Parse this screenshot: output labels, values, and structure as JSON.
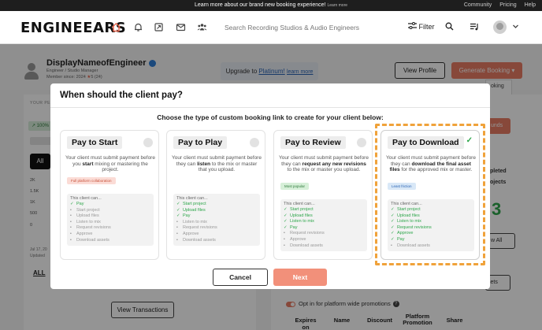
{
  "banner": {
    "message": "Learn more about our brand new booking experience!",
    "learn_more": "Learn more",
    "links": [
      "Community",
      "Pricing",
      "Help"
    ]
  },
  "nav": {
    "logo": "ENGINEEARS",
    "search_placeholder": "Search Recording Studios & Audio Engineers",
    "filter_label": "Filter",
    "icons": [
      "home-icon",
      "bell-icon",
      "document-icon",
      "mail-icon",
      "people-icon",
      "search-icon",
      "queue-icon",
      "avatar",
      "chevron-down-icon"
    ]
  },
  "profile": {
    "name": "DisplayNameofEngineer",
    "role": "Engineer / Studio Manager",
    "member_since": "Member since: 2024",
    "rating": "5 (24)",
    "upgrade_text": "Upgrade to ",
    "upgrade_link": "Platinum!",
    "learn_more": "learn more",
    "view_profile": "View Profile",
    "generate_booking": "Generate Booking",
    "dropdown_items": [
      "oking",
      "oking"
    ]
  },
  "background": {
    "your_label": "YOUR PE",
    "pct": "100%",
    "tab_all": "All",
    "y_ticks": [
      "2K",
      "1.5K",
      "1K",
      "500",
      "0"
    ],
    "date": "Jul 17, 20",
    "updated": "Updated",
    "all_tab": "ALL",
    "view_transactions": "View Transactions",
    "funds": "unds",
    "side_texts": [
      "pleted",
      "ojects"
    ],
    "big_number": "3",
    "view_all": "w All",
    "assets": "sets",
    "optin": "Opt in for platform wide promotions",
    "table_headers": [
      "Expires on",
      "Name",
      "Discount",
      "Platform Promotion",
      "Share"
    ]
  },
  "modal": {
    "title": "When should the client pay?",
    "subtitle": "Choose the type of custom booking link to create for your client below:",
    "cancel": "Cancel",
    "next": "Next",
    "perm_head": "This client can...",
    "cards": [
      {
        "title": "Pay to Start",
        "desc_pre": "Your client must submit payment before you ",
        "desc_bold": "start",
        "desc_post": " mixing or mastering the project.",
        "tag": "Full platform collaboration",
        "perms": [
          {
            "label": "Pay",
            "ok": true
          },
          {
            "label": "Start project",
            "ok": false
          },
          {
            "label": "Upload files",
            "ok": false
          },
          {
            "label": "Listen to mix",
            "ok": false
          },
          {
            "label": "Request revisions",
            "ok": false
          },
          {
            "label": "Approve",
            "ok": false
          },
          {
            "label": "Download assets",
            "ok": false
          }
        ]
      },
      {
        "title": "Pay to Play",
        "desc_pre": "Your client must submit payment before they can ",
        "desc_bold": "listen",
        "desc_post": " to the mix or master that you upload.",
        "tag": "",
        "perms": [
          {
            "label": "Start project",
            "ok": true
          },
          {
            "label": "Upload files",
            "ok": true
          },
          {
            "label": "Pay",
            "ok": true
          },
          {
            "label": "Listen to mix",
            "ok": false
          },
          {
            "label": "Request revisions",
            "ok": false
          },
          {
            "label": "Approve",
            "ok": false
          },
          {
            "label": "Download assets",
            "ok": false
          }
        ]
      },
      {
        "title": "Pay to Review",
        "desc_pre": "Your client must submit payment before they can ",
        "desc_bold": "request any new revisions",
        "desc_post": " to the mix or master you upload.",
        "tag": "Most popular",
        "perms": [
          {
            "label": "Start project",
            "ok": true
          },
          {
            "label": "Upload files",
            "ok": true
          },
          {
            "label": "Listen to mix",
            "ok": true
          },
          {
            "label": "Pay",
            "ok": true
          },
          {
            "label": "Request revisions",
            "ok": false
          },
          {
            "label": "Approve",
            "ok": false
          },
          {
            "label": "Download assets",
            "ok": false
          }
        ]
      },
      {
        "title": "Pay to Download",
        "desc_pre": "Your client must submit payment before they can ",
        "desc_bold": "download the final asset files",
        "desc_post": " for the approved mix or master.",
        "tag": "Least friction",
        "perms": [
          {
            "label": "Start project",
            "ok": true
          },
          {
            "label": "Upload files",
            "ok": true
          },
          {
            "label": "Listen to mix",
            "ok": true
          },
          {
            "label": "Request revisions",
            "ok": true
          },
          {
            "label": "Approve",
            "ok": true
          },
          {
            "label": "Pay",
            "ok": true
          },
          {
            "label": "Download assets",
            "ok": false
          }
        ]
      }
    ]
  },
  "colors": {
    "accent": "#e87c64",
    "next_button": "#f2907a",
    "check_green": "#2da64a",
    "highlight": "#f0a23a"
  }
}
